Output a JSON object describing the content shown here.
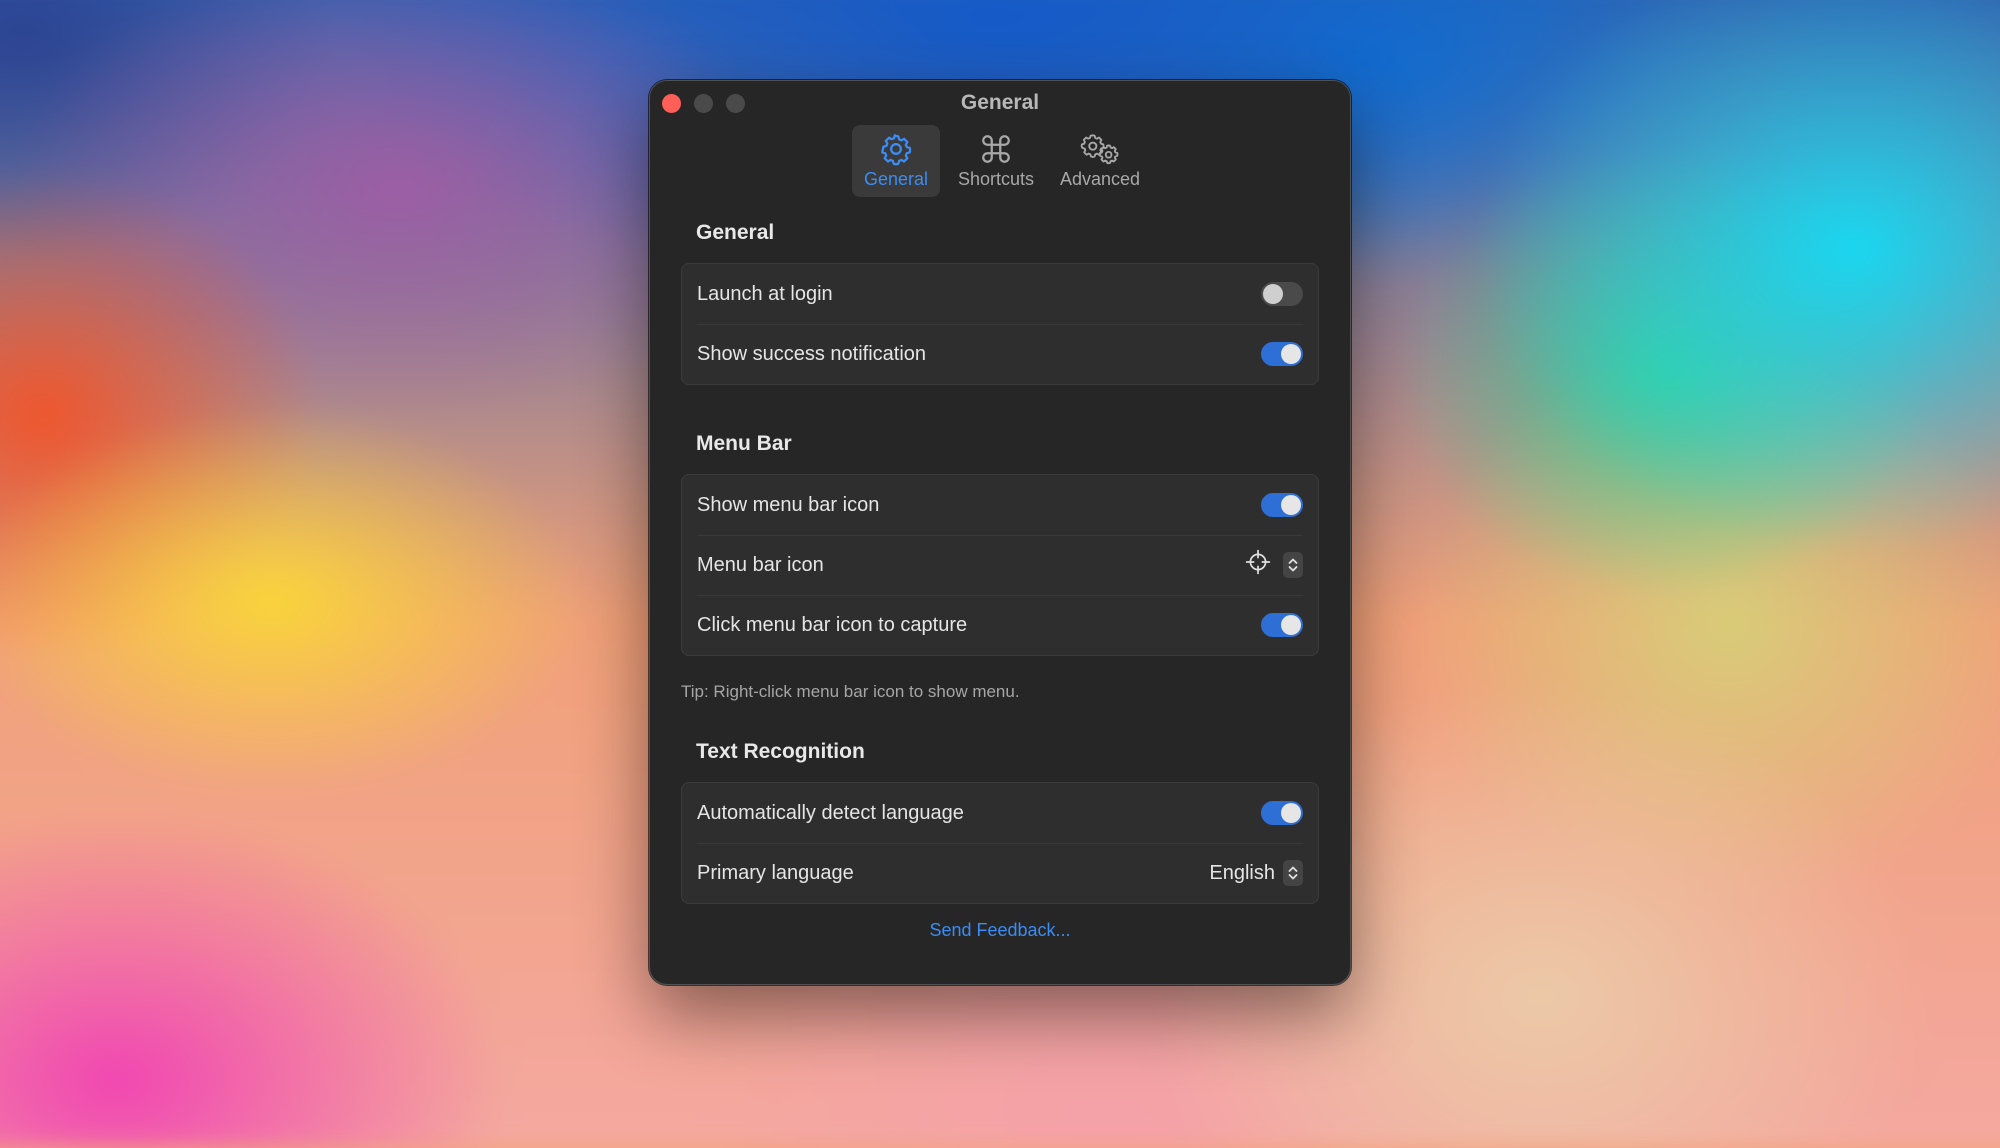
{
  "window": {
    "title": "General"
  },
  "tabs": [
    {
      "label": "General",
      "icon": "gear-icon",
      "selected": true
    },
    {
      "label": "Shortcuts",
      "icon": "command-icon",
      "selected": false
    },
    {
      "label": "Advanced",
      "icon": "gears-icon",
      "selected": false
    }
  ],
  "sections": {
    "general": {
      "title": "General",
      "rows": [
        {
          "label": "Launch at login",
          "control": "toggle",
          "value": false
        },
        {
          "label": "Show success notification",
          "control": "toggle",
          "value": true
        }
      ]
    },
    "menu_bar": {
      "title": "Menu Bar",
      "rows": [
        {
          "label": "Show menu bar icon",
          "control": "toggle",
          "value": true
        },
        {
          "label": "Menu bar icon",
          "control": "icon-picker",
          "value": "crosshair-icon"
        },
        {
          "label": "Click menu bar icon to capture",
          "control": "toggle",
          "value": true
        }
      ],
      "tip": "Tip: Right-click menu bar icon to show menu."
    },
    "text_recognition": {
      "title": "Text Recognition",
      "rows": [
        {
          "label": "Automatically detect language",
          "control": "toggle",
          "value": true
        },
        {
          "label": "Primary language",
          "control": "popup",
          "value": "English"
        }
      ]
    }
  },
  "footer": {
    "feedback_link": "Send Feedback..."
  },
  "colors": {
    "accent": "#3b8cf5",
    "toggle_on": "#2e6fd6",
    "window_bg": "#262626",
    "group_bg": "#2e2e2e",
    "close_button": "#ff5f57"
  }
}
